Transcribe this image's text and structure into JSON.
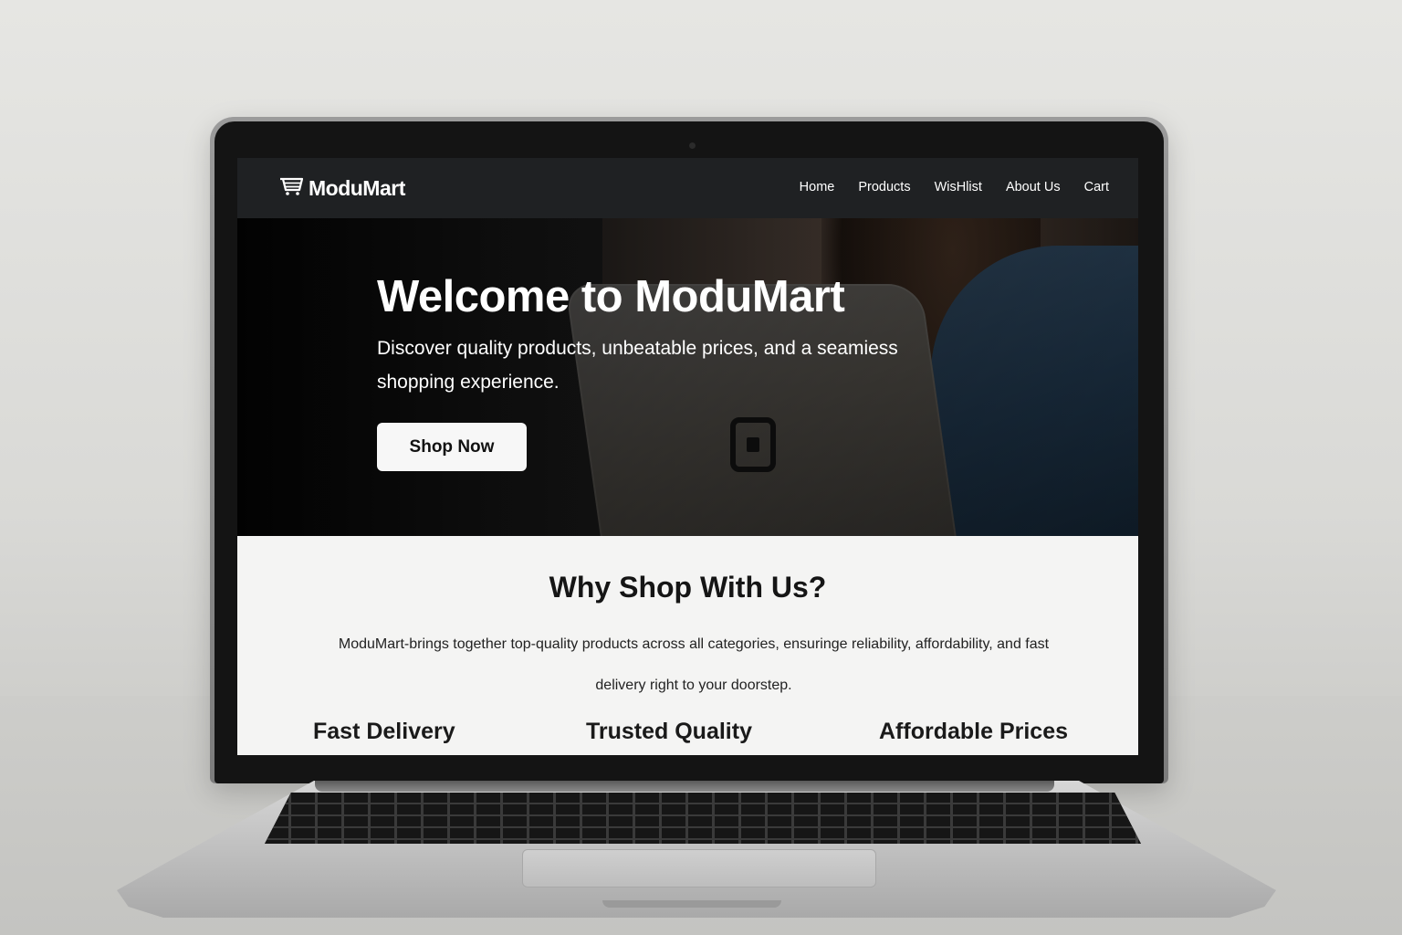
{
  "navbar": {
    "brand": "ModuMart",
    "brand_icon": "cart-icon",
    "links": [
      {
        "label": "Home"
      },
      {
        "label": "Products"
      },
      {
        "label": "WisHlist"
      },
      {
        "label": "About Us"
      },
      {
        "label": "Cart"
      }
    ]
  },
  "hero": {
    "title": "Welcome to ModuMart",
    "subtitle": "Discover quality products, unbeatable prices, and a seamiess shopping experience.",
    "cta_label": "Shop Now"
  },
  "why": {
    "title": "Why Shop With Us?",
    "description": "ModuMart-brings together top-quality products across all categories, ensuringe reliability, affordability, and fast delivery right to your doorstep.",
    "features": [
      {
        "label": "Fast Delivery"
      },
      {
        "label": "Trusted Quality"
      },
      {
        "label": "Affordable Prices"
      }
    ]
  },
  "colors": {
    "navbar_bg": "#1f2123",
    "page_bg": "#f4f4f3",
    "button_bg": "#f7f7f7"
  }
}
